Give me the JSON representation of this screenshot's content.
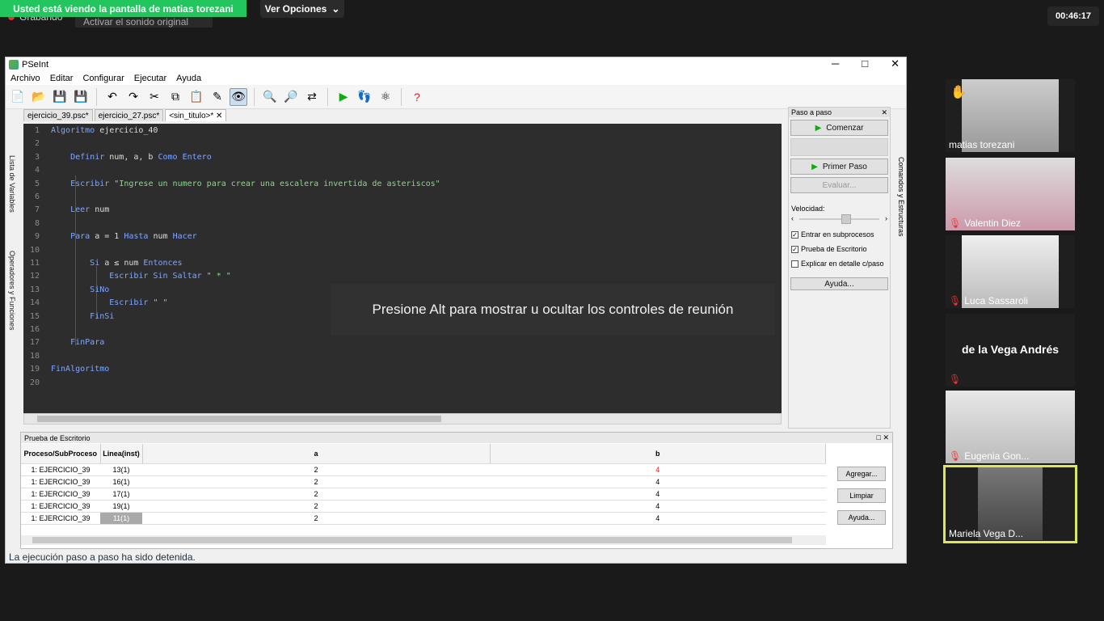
{
  "zoom": {
    "banner": "Usted está viendo la pantalla de matias torezani",
    "options_label": "Ver Opciones",
    "recording_label": "Grabando",
    "audio_label": "Activar el sonido original",
    "timer": "00:46:17"
  },
  "window": {
    "title": "PSeInt",
    "minimize": "─",
    "maximize": "□",
    "close": "✕"
  },
  "menu": [
    "Archivo",
    "Editar",
    "Configurar",
    "Ejecutar",
    "Ayuda"
  ],
  "left_strip": {
    "vars": "Lista de Variables",
    "ops": "Operadores y Funciones"
  },
  "tabs": [
    "ejercicio_39.psc*",
    "ejercicio_27.psc*",
    "<sin_titulo>*"
  ],
  "code_lines": [
    {
      "n": "1",
      "parts": [
        {
          "t": "Algoritmo",
          "c": "kw"
        },
        {
          "t": " ejercicio_40",
          "c": ""
        }
      ]
    },
    {
      "n": "2",
      "parts": []
    },
    {
      "n": "3",
      "parts": [
        {
          "t": "    ",
          "c": ""
        },
        {
          "t": "Definir",
          "c": "kw"
        },
        {
          "t": " num, a, b ",
          "c": ""
        },
        {
          "t": "Como Entero",
          "c": "kw"
        }
      ]
    },
    {
      "n": "4",
      "parts": []
    },
    {
      "n": "5",
      "parts": [
        {
          "t": "    ",
          "c": ""
        },
        {
          "t": "Escribir",
          "c": "kw"
        },
        {
          "t": " ",
          "c": ""
        },
        {
          "t": "\"Ingrese un numero para crear una escalera invertida de asteriscos\"",
          "c": "str"
        }
      ]
    },
    {
      "n": "6",
      "parts": []
    },
    {
      "n": "7",
      "parts": [
        {
          "t": "    ",
          "c": ""
        },
        {
          "t": "Leer",
          "c": "kw"
        },
        {
          "t": " num",
          "c": ""
        }
      ]
    },
    {
      "n": "8",
      "parts": []
    },
    {
      "n": "9",
      "parts": [
        {
          "t": "    ",
          "c": ""
        },
        {
          "t": "Para",
          "c": "kw"
        },
        {
          "t": " a = 1 ",
          "c": ""
        },
        {
          "t": "Hasta",
          "c": "kw"
        },
        {
          "t": " num ",
          "c": ""
        },
        {
          "t": "Hacer",
          "c": "kw"
        }
      ]
    },
    {
      "n": "10",
      "parts": []
    },
    {
      "n": "11",
      "parts": [
        {
          "t": "        ",
          "c": ""
        },
        {
          "t": "Si",
          "c": "kw"
        },
        {
          "t": " a ≤ num ",
          "c": ""
        },
        {
          "t": "Entonces",
          "c": "kw"
        }
      ]
    },
    {
      "n": "12",
      "parts": [
        {
          "t": "            ",
          "c": ""
        },
        {
          "t": "Escribir Sin Saltar",
          "c": "kw"
        },
        {
          "t": " ",
          "c": ""
        },
        {
          "t": "\" * \"",
          "c": "str"
        }
      ]
    },
    {
      "n": "13",
      "parts": [
        {
          "t": "        ",
          "c": ""
        },
        {
          "t": "SiNo",
          "c": "kw"
        }
      ]
    },
    {
      "n": "14",
      "parts": [
        {
          "t": "            ",
          "c": ""
        },
        {
          "t": "Escribir",
          "c": "kw"
        },
        {
          "t": " ",
          "c": ""
        },
        {
          "t": "\" \"",
          "c": "str"
        }
      ]
    },
    {
      "n": "15",
      "parts": [
        {
          "t": "        ",
          "c": ""
        },
        {
          "t": "FinSi",
          "c": "kw"
        }
      ]
    },
    {
      "n": "16",
      "parts": []
    },
    {
      "n": "17",
      "parts": [
        {
          "t": "    ",
          "c": ""
        },
        {
          "t": "FinPara",
          "c": "kw"
        }
      ]
    },
    {
      "n": "18",
      "parts": []
    },
    {
      "n": "19",
      "parts": [
        {
          "t": "FinAlgoritmo",
          "c": "kw"
        }
      ]
    },
    {
      "n": "20",
      "parts": []
    }
  ],
  "overlay": "Presione Alt para mostrar u ocultar los controles de reunión",
  "step_panel": {
    "title": "Paso a paso",
    "start": "Comenzar",
    "first_step": "Primer Paso",
    "evaluate": "Evaluar...",
    "speed": "Velocidad:",
    "chk1": "Entrar en subprocesos",
    "chk2": "Prueba de Escritorio",
    "chk3": "Explicar en detalle c/paso",
    "help": "Ayuda..."
  },
  "right_strip": "Comandos y Estructuras",
  "desk_test": {
    "title": "Prueba de Escritorio",
    "headers": [
      "Proceso/SubProceso",
      "Linea(inst)",
      "a",
      "b"
    ],
    "rows": [
      [
        "1: EJERCICIO_39",
        "13(1)",
        "2",
        "4"
      ],
      [
        "1: EJERCICIO_39",
        "16(1)",
        "2",
        "4"
      ],
      [
        "1: EJERCICIO_39",
        "17(1)",
        "2",
        "4"
      ],
      [
        "1: EJERCICIO_39",
        "19(1)",
        "2",
        "4"
      ],
      [
        "1: EJERCICIO_39",
        "11(1)",
        "2",
        "4"
      ]
    ],
    "add": "Agregar...",
    "clear": "Limpiar",
    "help": "Ayuda..."
  },
  "status": "La ejecución paso a paso ha sido detenida.",
  "participants": [
    {
      "name": "matias torezani",
      "muted": false
    },
    {
      "name": "Valentin Diez",
      "muted": true
    },
    {
      "name": "Luca Sassaroli",
      "muted": true
    },
    {
      "name": "de la Vega Andrés",
      "muted": true
    },
    {
      "name": "Eugenia Gon...",
      "muted": true
    },
    {
      "name": "Mariela Vega D...",
      "muted": false
    }
  ]
}
